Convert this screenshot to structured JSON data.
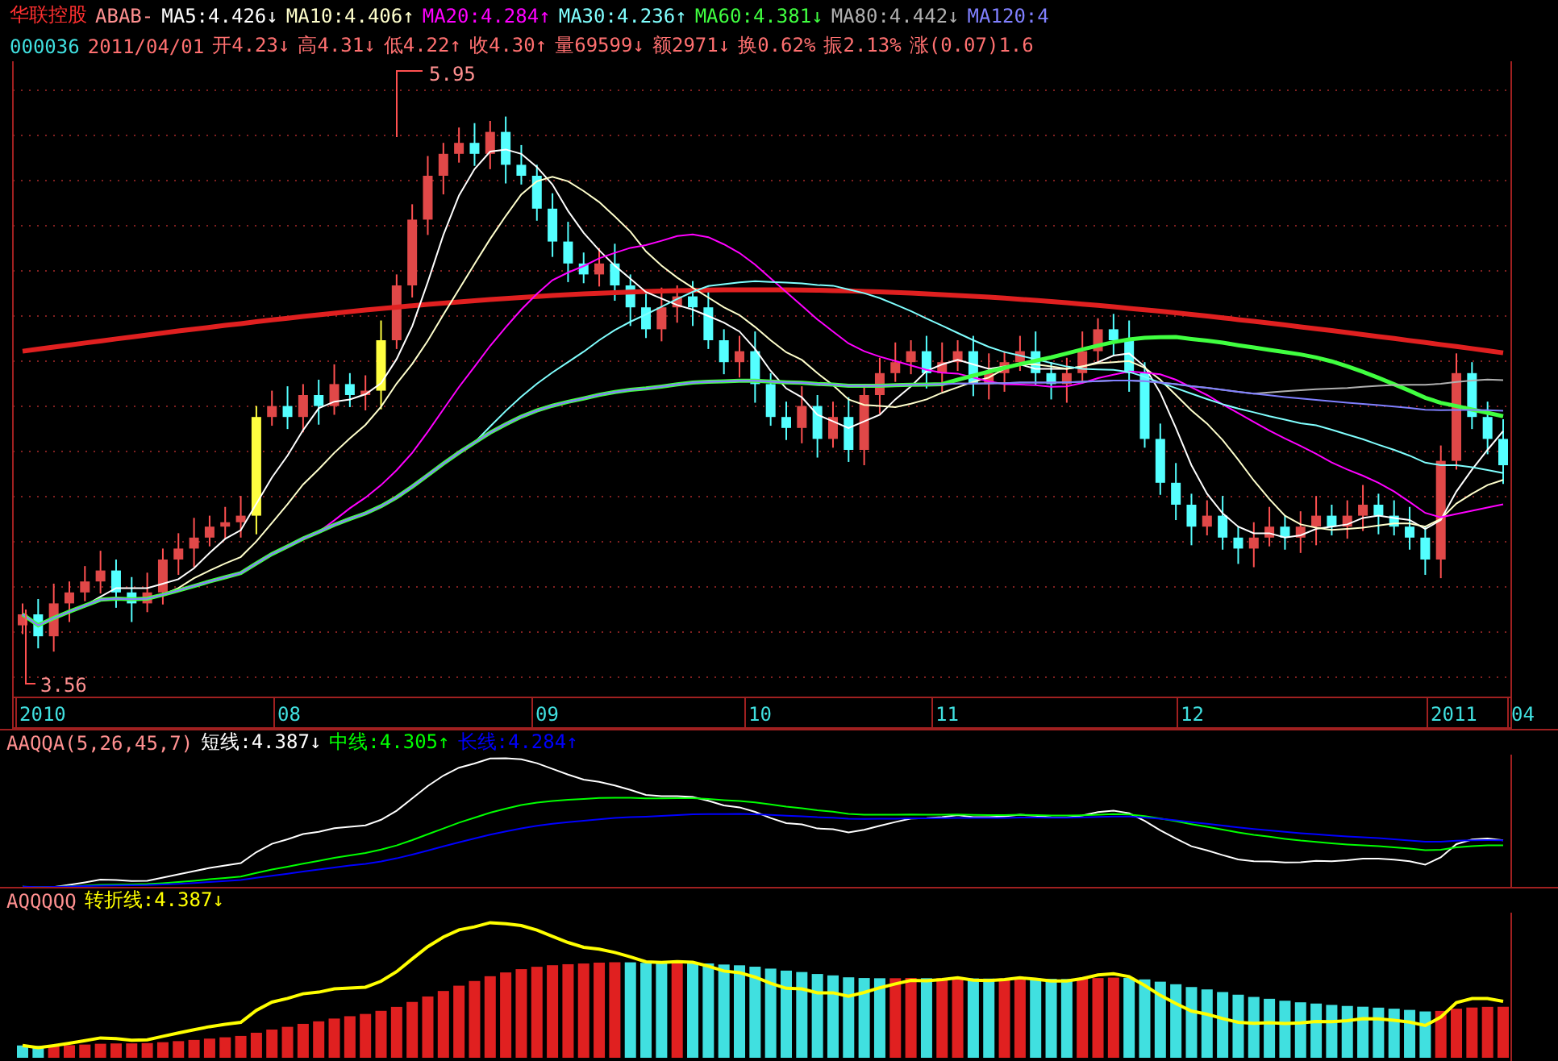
{
  "header": {
    "stock_name": "华联控股",
    "indicator": "ABAB-",
    "ma_values": [
      {
        "text": "MA5:4.426↓",
        "color": "#ffffff"
      },
      {
        "text": "MA10:4.406↑",
        "color": "#ffffcc"
      },
      {
        "text": "MA20:4.284↑",
        "color": "#ff00ff"
      },
      {
        "text": "MA30:4.236↑",
        "color": "#80ffff"
      },
      {
        "text": "MA60:4.381↓",
        "color": "#40ff40"
      },
      {
        "text": "MA80:4.442↓",
        "color": "#b0b0b0"
      },
      {
        "text": "MA120:4",
        "color": "#8080ff"
      }
    ]
  },
  "quote": {
    "code": "000036",
    "date": "2011/04/01",
    "fields": [
      "开4.23↓",
      "高4.31↓",
      "低4.22↑",
      "收4.30↑",
      "量69599↓",
      "额2971↓",
      "换0.62%",
      "振2.13%",
      "涨(0.07)1.6"
    ]
  },
  "main_chart": {
    "high_label": "5.95",
    "low_label": "3.56"
  },
  "date_axis": [
    {
      "label": "2010"
    },
    {
      "label": "08"
    },
    {
      "label": "09"
    },
    {
      "label": "10"
    },
    {
      "label": "11"
    },
    {
      "label": "12"
    },
    {
      "label": "2011"
    },
    {
      "label": "04"
    }
  ],
  "panel_2": {
    "name": "AAQQA(5,26,45,7)",
    "lines": [
      {
        "text": "短线:4.387↓",
        "color": "#ffffff"
      },
      {
        "text": "中线:4.305↑",
        "color": "#00ff00"
      },
      {
        "text": "长线:4.284↑",
        "color": "#0000ff"
      }
    ]
  },
  "panel_3": {
    "name": "AQQQQQ",
    "lines": [
      {
        "text": "转折线:4.387↓",
        "color": "#ffff00"
      }
    ]
  }
}
